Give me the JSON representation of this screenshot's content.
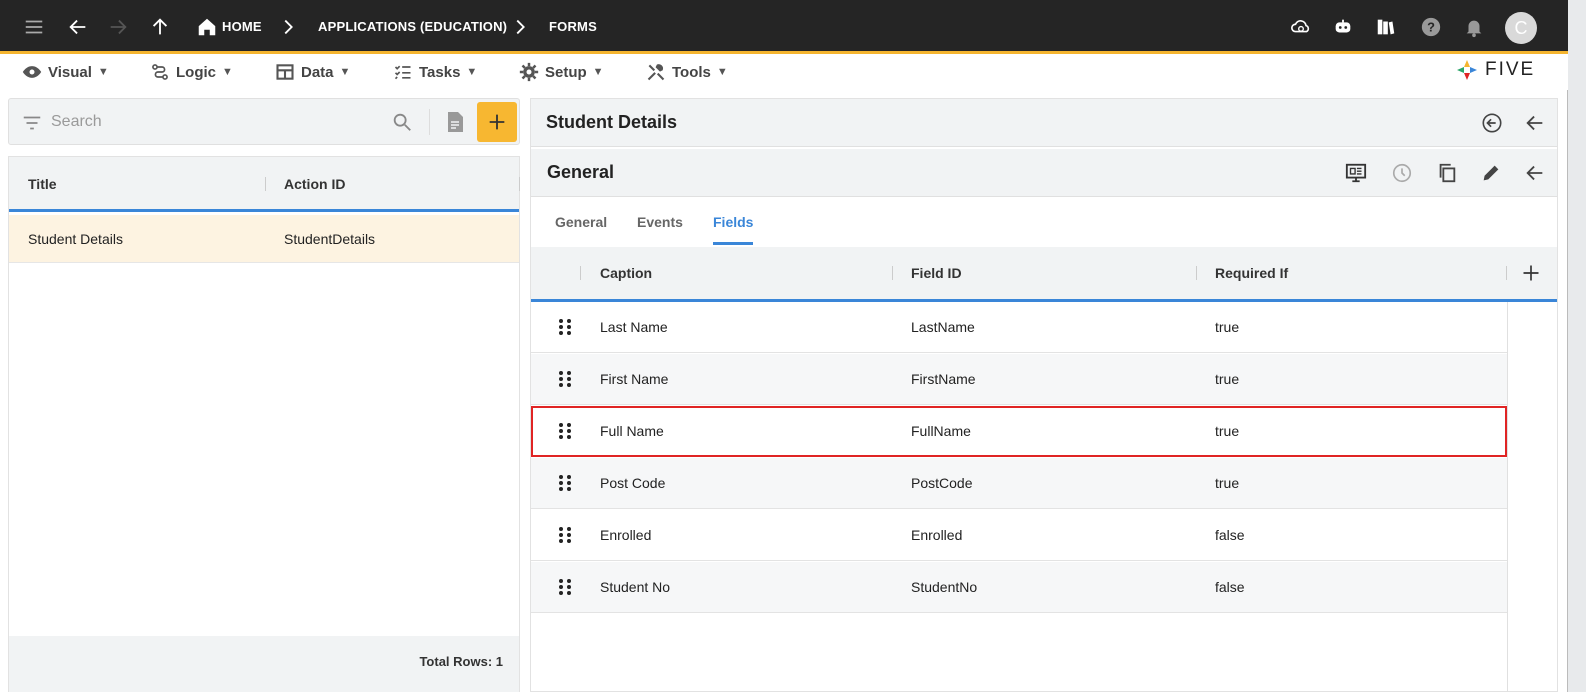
{
  "breadcrumb": {
    "home": "HOME",
    "applications": "APPLICATIONS (EDUCATION)",
    "forms": "FORMS"
  },
  "user": {
    "avatar_initial": "C"
  },
  "menu": [
    {
      "label": "Visual",
      "icon": "eye-icon"
    },
    {
      "label": "Logic",
      "icon": "logic-icon"
    },
    {
      "label": "Data",
      "icon": "table-icon"
    },
    {
      "label": "Tasks",
      "icon": "tasks-icon"
    },
    {
      "label": "Setup",
      "icon": "gear-icon"
    },
    {
      "label": "Tools",
      "icon": "tools-icon"
    }
  ],
  "menu_caret": "▼",
  "logo": {
    "text": "FIVE"
  },
  "search": {
    "placeholder": "Search",
    "value": ""
  },
  "left_list": {
    "columns": [
      "Title",
      "Action ID"
    ],
    "rows": [
      {
        "title": "Student Details",
        "action_id": "StudentDetails"
      }
    ],
    "total": "Total Rows: 1"
  },
  "detail": {
    "title": "Student Details",
    "section_title": "General",
    "tabs": [
      "General",
      "Events",
      "Fields"
    ],
    "active_tab": "Fields"
  },
  "fields_table": {
    "columns": [
      "Caption",
      "Field ID",
      "Required If"
    ],
    "rows": [
      {
        "caption": "Last Name",
        "field_id": "LastName",
        "required_if": "true"
      },
      {
        "caption": "First Name",
        "field_id": "FirstName",
        "required_if": "true"
      },
      {
        "caption": "Full Name",
        "field_id": "FullName",
        "required_if": "true",
        "highlighted": true
      },
      {
        "caption": "Post Code",
        "field_id": "PostCode",
        "required_if": "true"
      },
      {
        "caption": "Enrolled",
        "field_id": "Enrolled",
        "required_if": "false"
      },
      {
        "caption": "Student No",
        "field_id": "StudentNo",
        "required_if": "false"
      }
    ]
  },
  "colors": {
    "topbar": "#252525",
    "accent": "#f5b52f",
    "active_blue": "#3a86d8",
    "highlight_border": "#e02424",
    "selected_row": "#fdf3e1"
  }
}
